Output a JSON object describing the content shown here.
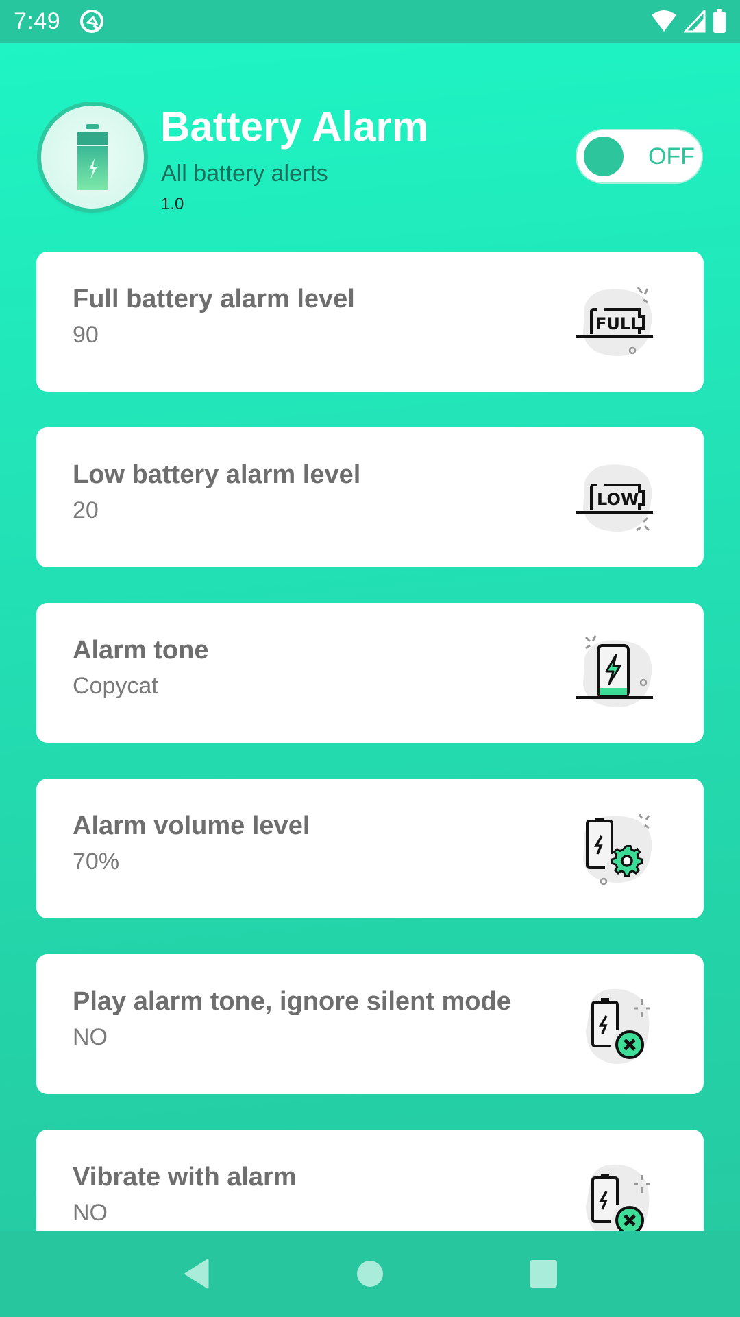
{
  "status_bar": {
    "time": "7:49",
    "icons": [
      "data-saver-icon",
      "wifi-icon",
      "cell-signal-icon",
      "battery-icon"
    ]
  },
  "header": {
    "title": "Battery Alarm",
    "subtitle": "All battery alerts",
    "version": "1.0",
    "logo_icon": "battery-charging-icon"
  },
  "master_toggle": {
    "state": "OFF",
    "label": "OFF"
  },
  "settings": [
    {
      "title": "Full battery alarm level",
      "value": "90",
      "icon": "battery-full-icon"
    },
    {
      "title": "Low battery alarm level",
      "value": "20",
      "icon": "battery-low-icon"
    },
    {
      "title": "Alarm tone",
      "value": "Copycat",
      "icon": "charging-phone-icon"
    },
    {
      "title": "Alarm volume level",
      "value": "70%",
      "icon": "battery-settings-icon"
    },
    {
      "title": "Play alarm tone, ignore silent mode",
      "value": "NO",
      "icon": "battery-cancel-icon"
    },
    {
      "title": "Vibrate with alarm",
      "value": "NO",
      "icon": "battery-cancel-icon"
    }
  ],
  "nav_bar": {
    "buttons": [
      "back",
      "home",
      "recents"
    ]
  },
  "colors": {
    "accent": "#2cc59c",
    "background_top": "#1ef6c5",
    "background_bottom": "#26c8a0",
    "bar": "#27c69e",
    "card_title": "#6e6e6e",
    "icon_green": "#3ddc97"
  }
}
